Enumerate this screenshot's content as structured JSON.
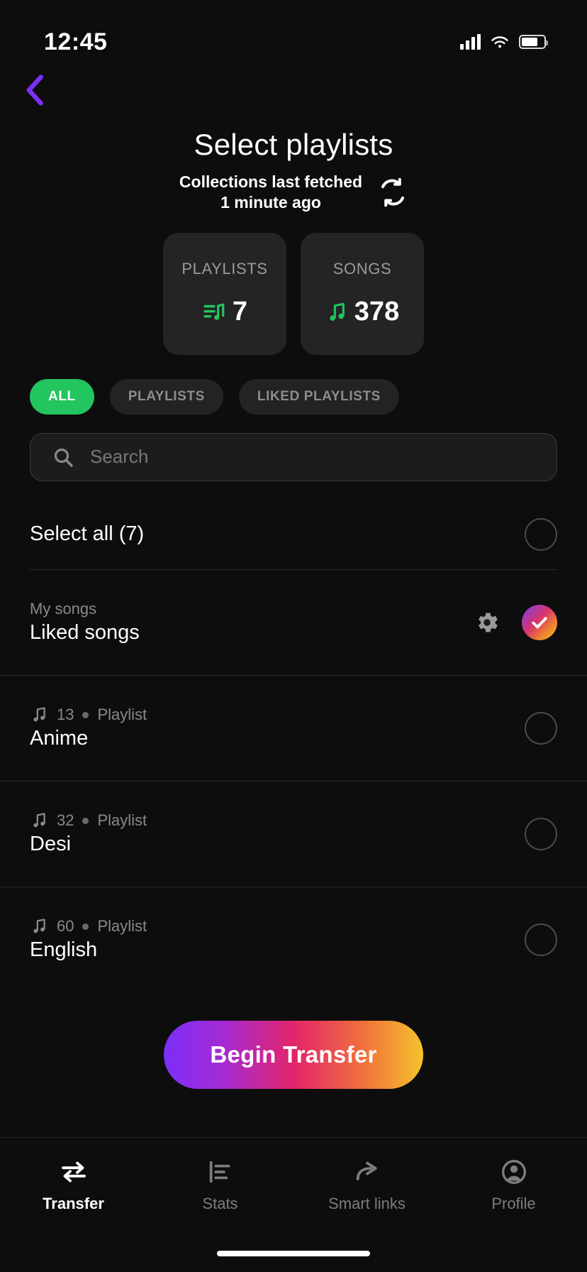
{
  "status_bar": {
    "time": "12:45",
    "signal_icon": "cellular-signal-icon",
    "wifi_icon": "wifi-icon",
    "battery_icon": "battery-icon"
  },
  "nav": {
    "back_icon": "chevron-left-icon",
    "back_color": "#7B2FF7"
  },
  "header": {
    "title": "Select playlists",
    "subtitle_line1": "Collections last fetched",
    "subtitle_line2": "1 minute ago",
    "refresh_icon": "refresh-sync-icon"
  },
  "stats": [
    {
      "label": "PLAYLISTS",
      "value": "7",
      "icon": "playlist-music-icon",
      "icon_color": "#22c55e"
    },
    {
      "label": "SONGS",
      "value": "378",
      "icon": "music-note-icon",
      "icon_color": "#22c55e"
    }
  ],
  "filters": {
    "active_color": "#22c55e",
    "chips": [
      {
        "label": "ALL",
        "active": true
      },
      {
        "label": "PLAYLISTS",
        "active": false
      },
      {
        "label": "LIKED PLAYLISTS",
        "active": false
      }
    ]
  },
  "search": {
    "placeholder": "Search",
    "value": "",
    "icon": "search-icon"
  },
  "select_all": {
    "label": "Select all (7)",
    "selected": false
  },
  "liked_songs": {
    "category": "My songs",
    "title": "Liked songs",
    "gear_icon": "gear-icon",
    "selected": true,
    "check_icon": "check-icon",
    "gradient": "linear-gradient(135deg,#7b3ff2,#d8356a,#ef8a2b,#f5b52a)"
  },
  "playlists": [
    {
      "count": "13",
      "type": "Playlist",
      "title": "Anime",
      "selected": false,
      "icon": "music-note-icon"
    },
    {
      "count": "32",
      "type": "Playlist",
      "title": "Desi",
      "selected": false,
      "icon": "music-note-icon"
    },
    {
      "count": "60",
      "type": "Playlist",
      "title": "English",
      "selected": false,
      "icon": "music-note-icon"
    }
  ],
  "cta": {
    "label": "Begin Transfer"
  },
  "tabs": [
    {
      "label": "Transfer",
      "icon": "transfer-arrows-icon",
      "active": true
    },
    {
      "label": "Stats",
      "icon": "bar-chart-icon",
      "active": false
    },
    {
      "label": "Smart links",
      "icon": "share-arrow-icon",
      "active": false
    },
    {
      "label": "Profile",
      "icon": "person-icon",
      "active": false
    }
  ]
}
